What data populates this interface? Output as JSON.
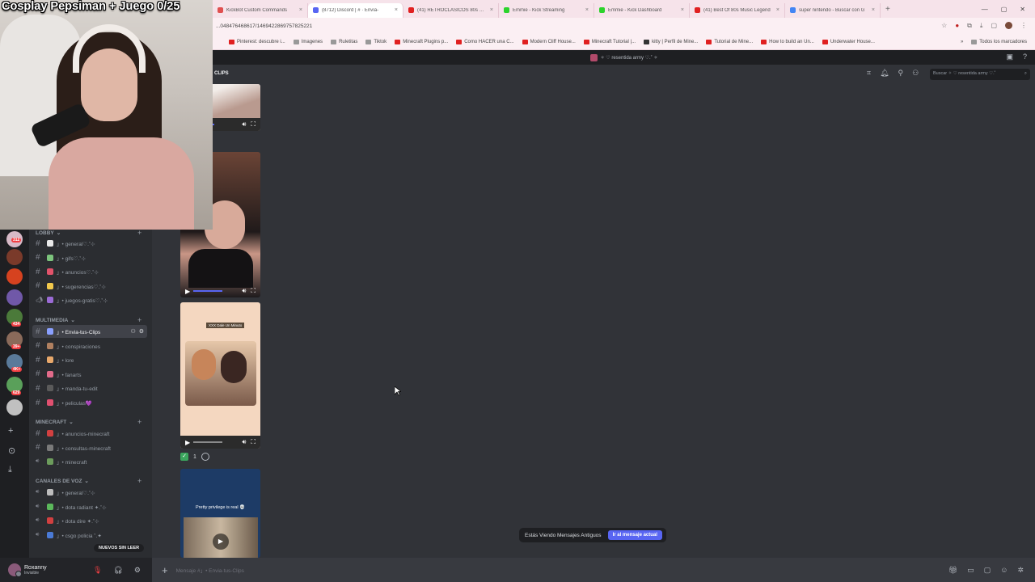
{
  "stream": {
    "title": "Cosplay Pepsiman + Juego 0/25"
  },
  "browser": {
    "tabs": [
      {
        "title": "KickBot Custom Commands",
        "color": "#e05050"
      },
      {
        "title": "(8712) Discord | # · Envía-",
        "color": "#5865f2",
        "active": true
      },
      {
        "title": "(41) RETROCLASICOS 80s & 90",
        "color": "#e02020"
      },
      {
        "title": "Emmie - Kick Streaming",
        "color": "#2cd32c"
      },
      {
        "title": "Emmie - Kick Dashboard",
        "color": "#2cd32c"
      },
      {
        "title": "(41) Best Of 80s Music Legend",
        "color": "#e02020"
      },
      {
        "title": "super nintendo - Buscar con G",
        "color": "#4285f4"
      }
    ],
    "url": "...048476468617/1469422869757825221",
    "bookmarks": [
      {
        "label": "Pinterest: descubre i...",
        "color": "#e02020"
      },
      {
        "label": "Imagenes",
        "color": "#999999"
      },
      {
        "label": "Ruletitas",
        "color": "#999999"
      },
      {
        "label": "Tiktok",
        "color": "#999999"
      },
      {
        "label": "Minecraft Plugins p...",
        "color": "#e02020"
      },
      {
        "label": "Como HACER una C...",
        "color": "#e02020"
      },
      {
        "label": "Modern Cliff House...",
        "color": "#e02020"
      },
      {
        "label": "Minecraft Tutorial |...",
        "color": "#e02020"
      },
      {
        "label": "kitty | Perfil de Mine...",
        "color": "#333333"
      },
      {
        "label": "Tutorial de Mine...",
        "color": "#e02020"
      },
      {
        "label": "How to build an Un...",
        "color": "#e02020"
      },
      {
        "label": "Underwater House...",
        "color": "#e02020"
      }
    ],
    "bookmarks_all": "Todos los marcadores"
  },
  "discord": {
    "server_title": "✧ ♡ resentida army ♡.˚ ✧",
    "channel_header": "Clips",
    "search_placeholder": "Buscar ✧ ♡ resentida army ♡.˚",
    "categories": [
      {
        "label": "LOBBY"
      },
      {
        "label": "MULTIMEDIA"
      },
      {
        "label": "MINECRAFT"
      },
      {
        "label": "CANALES DE VOZ"
      }
    ],
    "channels_lobby": [
      {
        "label": "」• general♡.˚⊹",
        "emo": "#e9e9e9",
        "type": "text"
      },
      {
        "label": "」• gifs♡.˚⊹",
        "emo": "#7cc47c",
        "type": "text"
      },
      {
        "label": "」• anuncios♡.˚⊹",
        "emo": "#e2536b",
        "type": "text"
      },
      {
        "label": "」• sugerencias♡.˚⊹",
        "emo": "#f2c94c",
        "type": "text"
      },
      {
        "label": "」• juegos-gratis♡.˚⊹",
        "emo": "#9b6bd6",
        "type": "announce"
      }
    ],
    "channels_multimedia": [
      {
        "label": "」• Envia-tus-Clips",
        "emo": "#8aa0ff",
        "type": "text",
        "selected": true
      },
      {
        "label": "」• conspiraciones",
        "emo": "#b08060",
        "type": "text"
      },
      {
        "label": "」• lore",
        "emo": "#e8a86b",
        "type": "text"
      },
      {
        "label": "」• fanarts",
        "emo": "#e26b8a",
        "type": "text"
      },
      {
        "label": "」• manda-tu-edit",
        "emo": "#5a5a5a",
        "type": "text"
      },
      {
        "label": "」• peliculas💜",
        "emo": "#e05070",
        "type": "text"
      }
    ],
    "channels_minecraft": [
      {
        "label": "」• anuncios-minecraft",
        "emo": "#d24040",
        "type": "text"
      },
      {
        "label": "」• consultas-minecraft",
        "emo": "#7a7a7a",
        "type": "text"
      },
      {
        "label": "」• minecraft",
        "emo": "#6c9c5c",
        "type": "voice"
      }
    ],
    "channels_voice": [
      {
        "label": "」• general♡.˚⊹",
        "emo": "#bdbdbd",
        "type": "voice"
      },
      {
        "label": "」• dota radiant ✦.˚⊹",
        "emo": "#5bb85b",
        "type": "voice"
      },
      {
        "label": "」• dota dire ✦.˚⊹",
        "emo": "#d24040",
        "type": "voice"
      },
      {
        "label": "」• csgo policia ˚.✦",
        "emo": "#4a7ad6",
        "type": "voice"
      }
    ],
    "unread_pill": "NUEVOS SIN LEER",
    "server_badges": [
      "312",
      "434",
      "39+",
      "4K+",
      "629"
    ],
    "user": {
      "name": "Roxanny",
      "status": "Invisible"
    },
    "composer_placeholder": "Mensaje #」• Envia-tus-Clips",
    "old_messages": "Estás Viendo Mensajes Antiguos",
    "jump_button": "Ir al mensaje actual",
    "clip_caption": "Pretty privilege is real 💀",
    "clip_overlay_top": "XXX Dale Un Minuto",
    "reaction_count": "1",
    "colors": {
      "accent": "#5865f2",
      "bg": "#313338",
      "sidebar": "#2b2d31",
      "rail": "#1e1f22"
    }
  }
}
